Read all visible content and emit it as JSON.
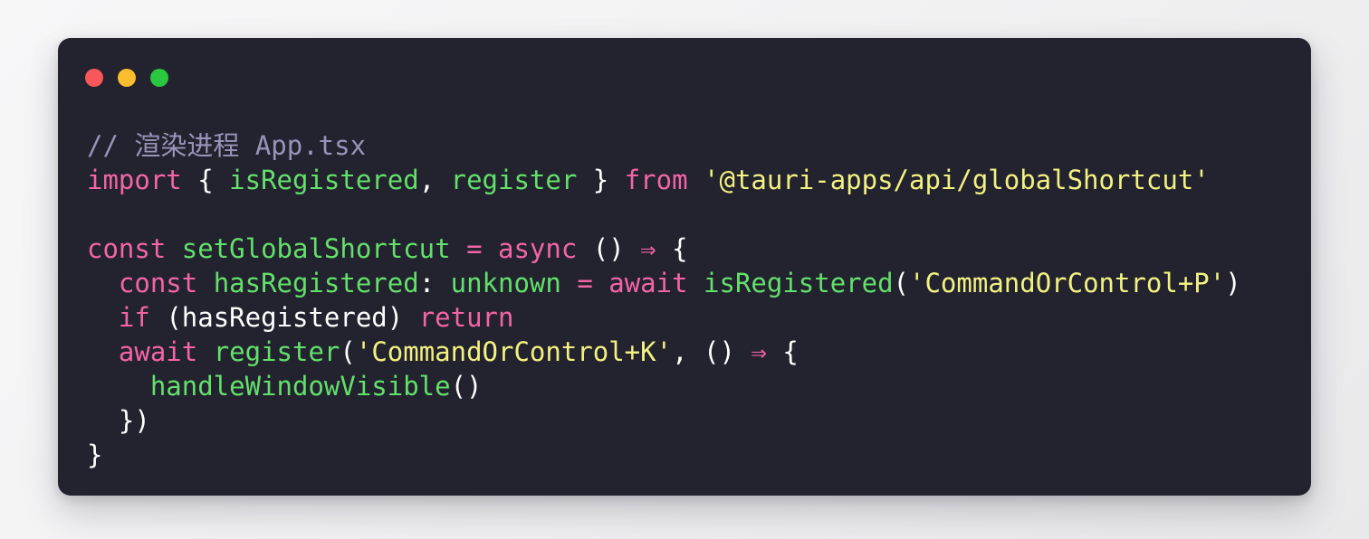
{
  "window": {
    "traffic_lights": [
      {
        "name": "close",
        "color": "#f9585a"
      },
      {
        "name": "minimize",
        "color": "#fcbd2e"
      },
      {
        "name": "maximize",
        "color": "#2ac841"
      }
    ],
    "card_background": "#23222f",
    "page_background": "#f5f5f6"
  },
  "theme": {
    "comment": "#9a93b8",
    "keyword": "#f265a6",
    "function": "#62e06a",
    "string": "#f2f281",
    "punctuation": "#ffffff",
    "plain": "#ffffff"
  },
  "code": {
    "language": "tsx",
    "lines": [
      {
        "indent": 0,
        "tokens": [
          {
            "t": "// 渲染进程 App.tsx",
            "c": "comment"
          }
        ]
      },
      {
        "indent": 0,
        "tokens": [
          {
            "t": "import",
            "c": "keyword"
          },
          {
            "t": " ",
            "c": "plain"
          },
          {
            "t": "{",
            "c": "punct"
          },
          {
            "t": " ",
            "c": "plain"
          },
          {
            "t": "isRegistered",
            "c": "func"
          },
          {
            "t": ",",
            "c": "punct"
          },
          {
            "t": " ",
            "c": "plain"
          },
          {
            "t": "register",
            "c": "func"
          },
          {
            "t": " ",
            "c": "plain"
          },
          {
            "t": "}",
            "c": "punct"
          },
          {
            "t": " ",
            "c": "plain"
          },
          {
            "t": "from",
            "c": "keyword"
          },
          {
            "t": " ",
            "c": "plain"
          },
          {
            "t": "'@tauri-apps/api/globalShortcut'",
            "c": "string"
          }
        ]
      },
      {
        "indent": 0,
        "tokens": []
      },
      {
        "indent": 0,
        "tokens": [
          {
            "t": "const",
            "c": "keyword"
          },
          {
            "t": " ",
            "c": "plain"
          },
          {
            "t": "setGlobalShortcut",
            "c": "func"
          },
          {
            "t": " ",
            "c": "plain"
          },
          {
            "t": "=",
            "c": "keyword"
          },
          {
            "t": " ",
            "c": "plain"
          },
          {
            "t": "async",
            "c": "keyword"
          },
          {
            "t": " ",
            "c": "plain"
          },
          {
            "t": "()",
            "c": "punct"
          },
          {
            "t": " ",
            "c": "plain"
          },
          {
            "t": "⇒",
            "c": "arrow"
          },
          {
            "t": " ",
            "c": "plain"
          },
          {
            "t": "{",
            "c": "punct"
          }
        ]
      },
      {
        "indent": 2,
        "tokens": [
          {
            "t": "const",
            "c": "keyword"
          },
          {
            "t": " ",
            "c": "plain"
          },
          {
            "t": "hasRegistered",
            "c": "func"
          },
          {
            "t": ":",
            "c": "punct"
          },
          {
            "t": " ",
            "c": "plain"
          },
          {
            "t": "unknown",
            "c": "func"
          },
          {
            "t": " ",
            "c": "plain"
          },
          {
            "t": "=",
            "c": "keyword"
          },
          {
            "t": " ",
            "c": "plain"
          },
          {
            "t": "await",
            "c": "keyword"
          },
          {
            "t": " ",
            "c": "plain"
          },
          {
            "t": "isRegistered",
            "c": "func"
          },
          {
            "t": "(",
            "c": "punct"
          },
          {
            "t": "'CommandOrControl+P'",
            "c": "string"
          },
          {
            "t": ")",
            "c": "punct"
          }
        ]
      },
      {
        "indent": 2,
        "tokens": [
          {
            "t": "if",
            "c": "keyword"
          },
          {
            "t": " ",
            "c": "plain"
          },
          {
            "t": "(",
            "c": "punct"
          },
          {
            "t": "hasRegistered",
            "c": "plain"
          },
          {
            "t": ")",
            "c": "punct"
          },
          {
            "t": " ",
            "c": "plain"
          },
          {
            "t": "return",
            "c": "keyword"
          }
        ]
      },
      {
        "indent": 2,
        "tokens": [
          {
            "t": "await",
            "c": "keyword"
          },
          {
            "t": " ",
            "c": "plain"
          },
          {
            "t": "register",
            "c": "func"
          },
          {
            "t": "(",
            "c": "punct"
          },
          {
            "t": "'CommandOrControl+K'",
            "c": "string"
          },
          {
            "t": ",",
            "c": "punct"
          },
          {
            "t": " ",
            "c": "plain"
          },
          {
            "t": "()",
            "c": "punct"
          },
          {
            "t": " ",
            "c": "plain"
          },
          {
            "t": "⇒",
            "c": "arrow"
          },
          {
            "t": " ",
            "c": "plain"
          },
          {
            "t": "{",
            "c": "punct"
          }
        ]
      },
      {
        "indent": 4,
        "tokens": [
          {
            "t": "handleWindowVisible",
            "c": "func"
          },
          {
            "t": "()",
            "c": "punct"
          }
        ]
      },
      {
        "indent": 2,
        "tokens": [
          {
            "t": "})",
            "c": "punct"
          }
        ]
      },
      {
        "indent": 0,
        "tokens": [
          {
            "t": "}",
            "c": "punct"
          }
        ]
      }
    ]
  }
}
